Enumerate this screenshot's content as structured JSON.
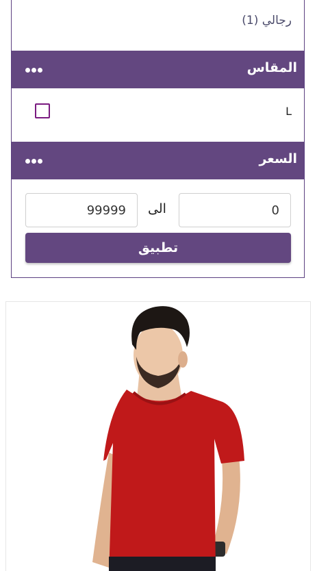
{
  "filters": {
    "category": {
      "label": "رجالي (1)"
    },
    "size": {
      "title": "المقاس",
      "options": [
        {
          "label": "L",
          "checked": false
        }
      ]
    },
    "price": {
      "title": "السعر",
      "from_value": "0",
      "to_label": "الى",
      "to_value": "99999",
      "apply_label": "تطبيق"
    }
  },
  "colors": {
    "accent": "#634780",
    "checkbox_border": "#7a1a80",
    "shirt": "#c0191a"
  },
  "icons": {
    "section_menu": "more-dots-icon"
  },
  "product": {
    "image": "red-tshirt-model-photo"
  }
}
